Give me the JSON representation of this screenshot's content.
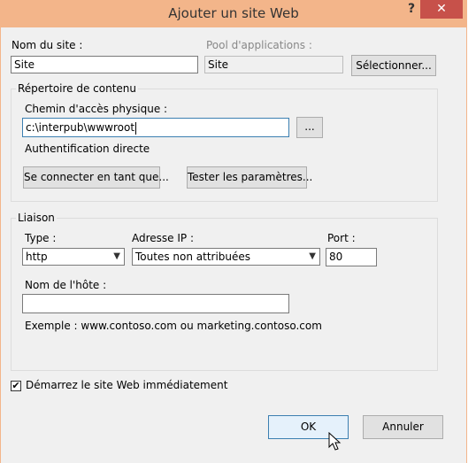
{
  "window": {
    "title": "Ajouter un site Web",
    "help_glyph": "?",
    "close_glyph": "✕"
  },
  "site": {
    "name_label": "Nom du site :",
    "name_value": "Site",
    "pool_label": "Pool d'applications :",
    "pool_value": "Site",
    "select_button": "Sélectionner..."
  },
  "content_dir": {
    "group_label": "Répertoire de contenu",
    "path_label": "Chemin d'accès physique :",
    "path_value": "c:\\interpub\\wwwroot",
    "browse_button": "...",
    "auth_label": "Authentification directe",
    "connect_button": "Se connecter en tant que...",
    "test_button": "Tester les paramètres..."
  },
  "binding": {
    "group_label": "Liaison",
    "type_label": "Type :",
    "type_value": "http",
    "ip_label": "Adresse IP :",
    "ip_value": "Toutes non attribuées",
    "port_label": "Port :",
    "port_value": "80",
    "host_label": "Nom de l'hôte :",
    "host_value": "",
    "example_text": "Exemple : www.contoso.com ou marketing.contoso.com"
  },
  "start": {
    "label": "Démarrez le site Web immédiatement",
    "checked": "✔"
  },
  "footer": {
    "ok_button": "OK",
    "cancel_button": "Annuler"
  },
  "colors": {
    "titlebar": "#f3b58a",
    "close": "#c7514a",
    "dialog_bg": "#f0f0f0"
  }
}
